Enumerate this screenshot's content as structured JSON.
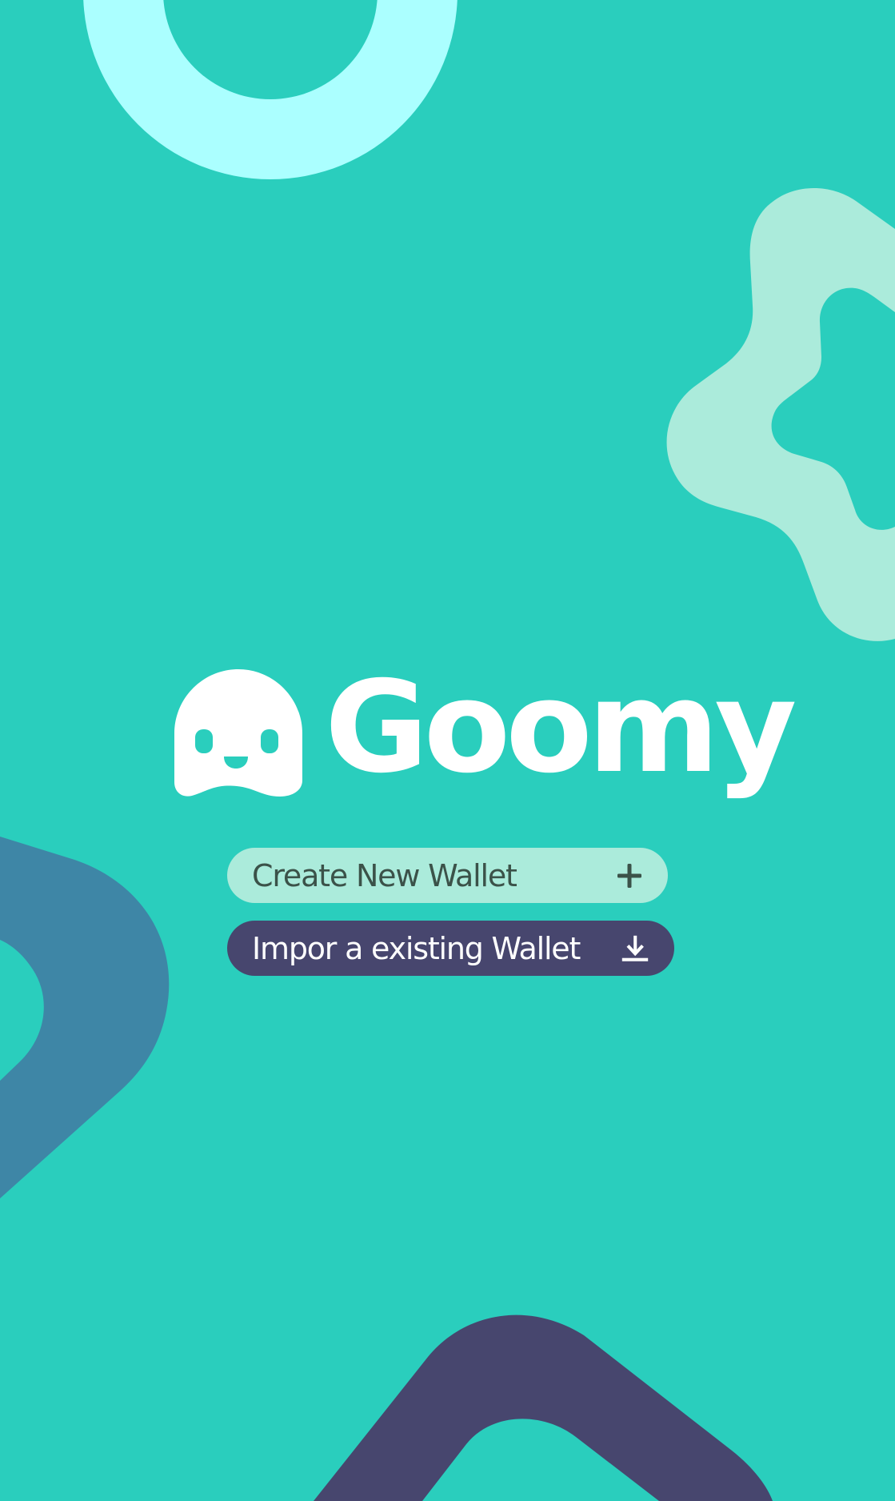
{
  "app": {
    "name": "Goomy"
  },
  "actions": {
    "create_label": "Create New Wallet",
    "create_icon": "plus-icon",
    "import_label": "Impor a existing Wallet",
    "import_icon": "download-icon"
  },
  "colors": {
    "background": "#2ACEBD",
    "create_button_bg": "#ABEBDB",
    "create_button_text": "#3B5249",
    "import_button_bg": "#47466E",
    "import_button_text": "#FFFFFF",
    "logo": "#FFFFFF",
    "deco_ring": "#ABFFFF",
    "deco_star": "#ABEBDB",
    "deco_arc_left": "#3E86A6",
    "deco_arc_bottom": "#47466E"
  }
}
